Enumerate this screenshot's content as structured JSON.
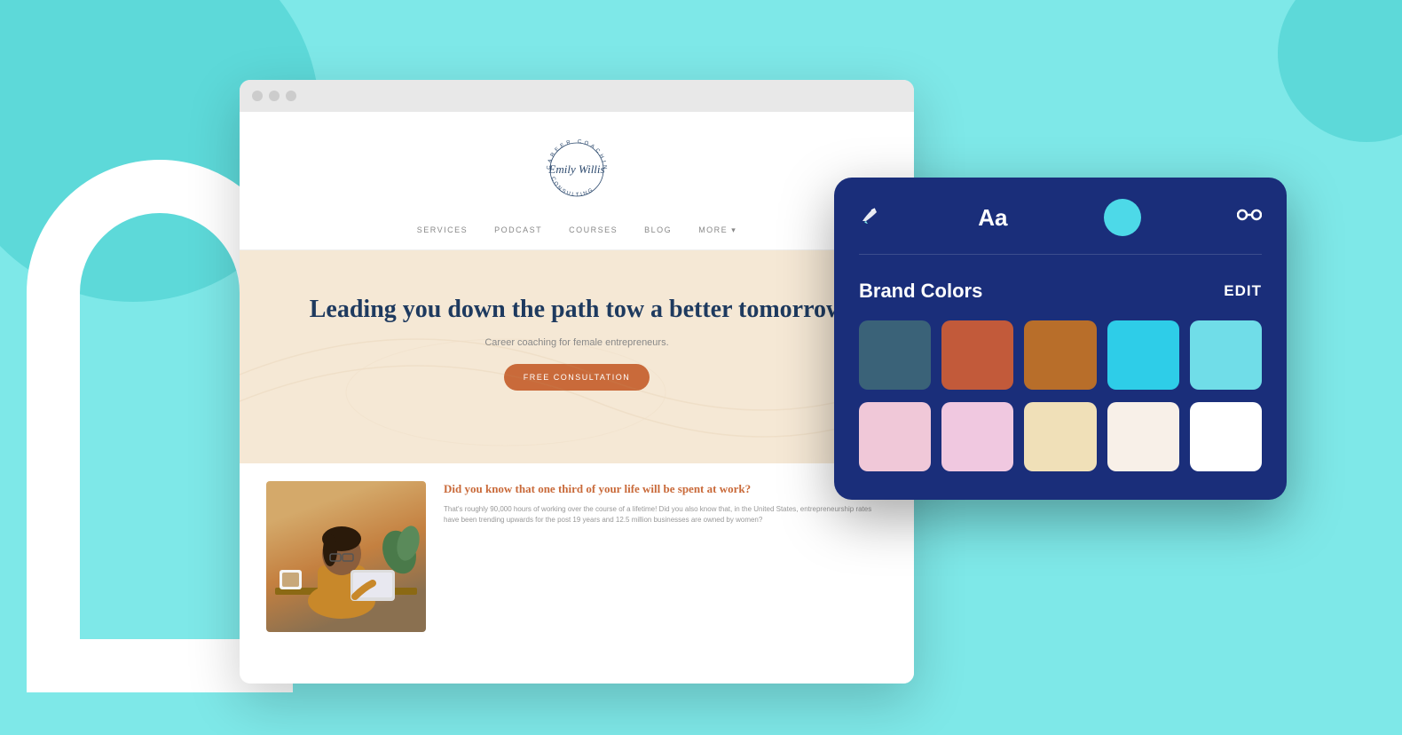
{
  "background": {
    "color": "#7ee8e8"
  },
  "browser": {
    "dots": [
      "dot1",
      "dot2",
      "dot3"
    ]
  },
  "website": {
    "logo_name": "Emily Willis",
    "logo_circle_text": "CAREER COACHING",
    "nav_items": [
      "SERVICES",
      "PODCAST",
      "COURSES",
      "BLOG",
      "MORE ▾"
    ],
    "hero_title": "Leading you down the path tow a better tomorrow",
    "hero_subtitle": "Career coaching for female entrepreneurs.",
    "hero_button": "FREE CONSULTATION",
    "content_heading_normal": "Did you know that ",
    "content_heading_highlight": "one third",
    "content_heading_end": " of your life will be spent at work?",
    "content_body": "That's roughly 90,000 hours of working over the course of a lifetime! Did you also know that, in the United States, entrepreneurship rates have been trending upwards for the post 19 years and 12.5 million businesses are owned by women?"
  },
  "brand_panel": {
    "title": "Brand Colors",
    "edit_label": "EDIT",
    "toolbar": {
      "brush_icon": "🖌",
      "typography_label": "Aa",
      "link_icon": "🔗"
    },
    "colors_row1": [
      "#3a6278",
      "#c25a3a",
      "#b86e2a",
      "#2ecde8",
      "#70dde8"
    ],
    "colors_row2": [
      "#f0c8d8",
      "#f0c8e0",
      "#f0e0b8",
      "#f8f0e8",
      "#ffffff"
    ]
  }
}
